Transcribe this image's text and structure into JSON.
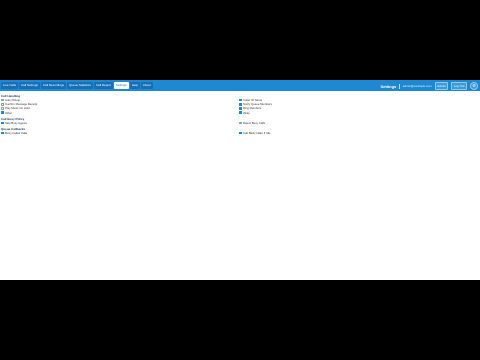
{
  "topbar": {
    "tabs": [
      {
        "label": "Live Calls"
      },
      {
        "label": "Call Settings"
      },
      {
        "label": "Call Recordings"
      },
      {
        "label": "Queue Statistics"
      },
      {
        "label": "Call Report"
      },
      {
        "label": "Settings",
        "active": true
      },
      {
        "label": "Help"
      },
      {
        "label": "About"
      }
    ],
    "title": "Settings",
    "user": "admin@example.com",
    "role_pill": "Admin",
    "logout_pill": "Log Out"
  },
  "sections": [
    {
      "title": "Call Handling",
      "rows": [
        [
          {
            "label": "Auto Pickup",
            "checked": false
          },
          {
            "label": "Caller ID Name",
            "checked": true
          }
        ],
        [
          {
            "label": "Confirm Message Receipt",
            "checked": false
          },
          {
            "label": "Notify Queue Members",
            "checked": true
          }
        ],
        [
          {
            "label": "Play Music On Hold",
            "checked": false
          },
          {
            "label": "Ring Members",
            "checked": true
          }
        ],
        [
          {
            "label": "Other",
            "checked": true
          },
          {
            "label": "Wrap",
            "checked": true
          }
        ]
      ]
    },
    {
      "title": "Call Busy Policy",
      "rows": [
        [
          {
            "label": "Skip Busy Agents",
            "checked": true
          },
          {
            "label": "Reject Busy Calls",
            "checked": false
          }
        ]
      ]
    },
    {
      "title": "Queue Callbacks",
      "rows": [
        [
          {
            "label": "Retry Failed Calls",
            "checked": true
          },
          {
            "label": "Call Back Caller If Idle",
            "checked": true
          }
        ]
      ]
    }
  ]
}
